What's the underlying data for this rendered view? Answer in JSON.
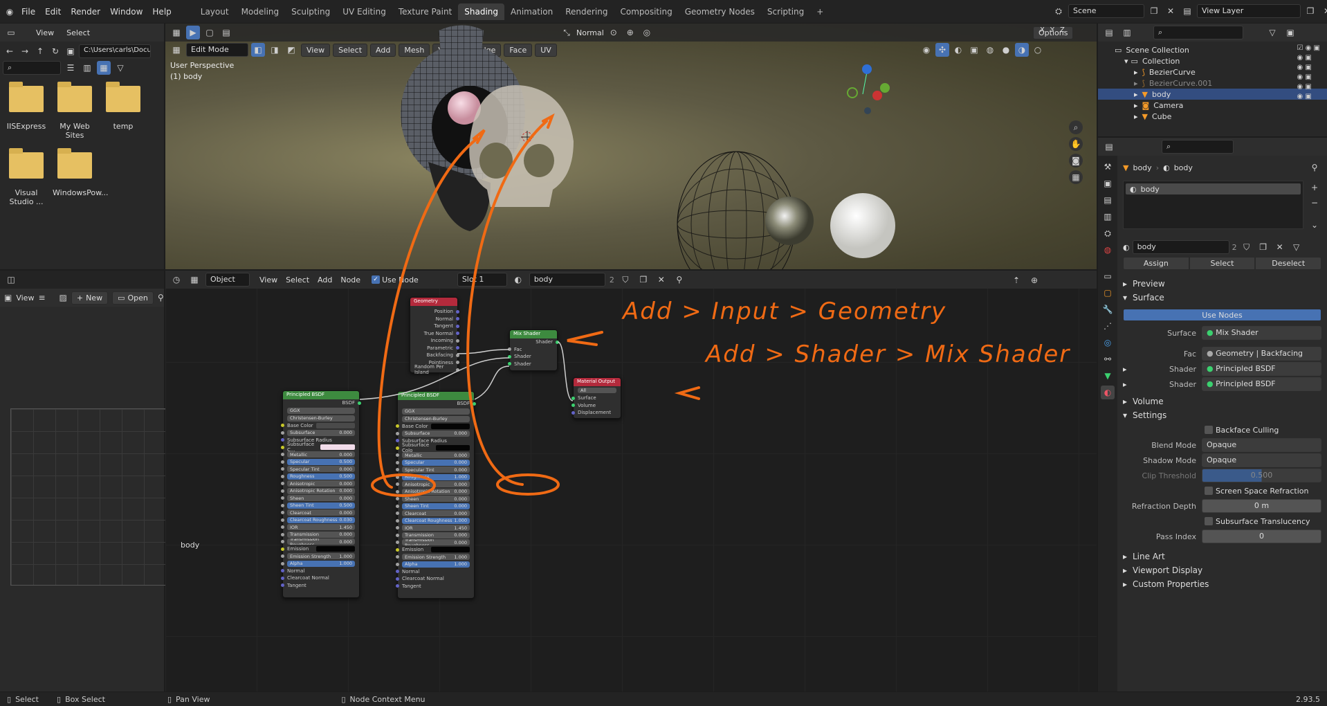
{
  "topbar": {
    "menus": [
      "File",
      "Edit",
      "Render",
      "Window",
      "Help"
    ],
    "workspaces": [
      "Layout",
      "Modeling",
      "Sculpting",
      "UV Editing",
      "Texture Paint",
      "Shading",
      "Animation",
      "Rendering",
      "Compositing",
      "Geometry Nodes",
      "Scripting"
    ],
    "active_workspace": "Shading",
    "scene": "Scene",
    "view_layer": "View Layer"
  },
  "file_browser": {
    "menus": [
      "View",
      "Select"
    ],
    "path": "C:\\Users\\carls\\Docum...",
    "folders": [
      "IISExpress",
      "My Web Sites",
      "temp",
      "Visual Studio ...",
      "WindowsPow..."
    ]
  },
  "image_editor": {
    "view": "View",
    "new": "New",
    "open": "Open"
  },
  "viewport": {
    "mode": "Edit Mode",
    "menus": [
      "View",
      "Select",
      "Add",
      "Mesh",
      "Vertex",
      "Edge",
      "Face",
      "UV"
    ],
    "perspective": "User Perspective",
    "object": "(1) body",
    "shading": "Normal",
    "options": "Options",
    "axes": [
      "X",
      "Y",
      "Z"
    ]
  },
  "node_editor": {
    "type": "Object",
    "menus": [
      "View",
      "Select",
      "Add",
      "Node"
    ],
    "use_nodes": "Use Node",
    "slot": "Slot 1",
    "material": "body",
    "users": "2",
    "label": "body",
    "geometry_node": {
      "title": "Geometry",
      "outputs": [
        "Position",
        "Normal",
        "Tangent",
        "True Normal",
        "Incoming",
        "Parametric",
        "Backfacing",
        "Pointiness",
        "Random Per Island"
      ]
    },
    "mix_node": {
      "title": "Mix Shader",
      "output": "Shader",
      "inputs": [
        "Fac",
        "Shader",
        "Shader"
      ]
    },
    "output_node": {
      "title": "Material Output",
      "target": "All",
      "inputs": [
        "Surface",
        "Volume",
        "Displacement"
      ]
    },
    "bsdf1": {
      "title": "Principled BSDF",
      "out": "BSDF",
      "dist": "GGX",
      "sss": "Christensen-Burley",
      "rows": [
        [
          "Base Color",
          ""
        ],
        [
          "Subsurface",
          "0.000"
        ],
        [
          "Subsurface Radius",
          ""
        ],
        [
          "Subsurface C...",
          ""
        ],
        [
          "Metallic",
          "0.000"
        ],
        [
          "Specular",
          "0.500"
        ],
        [
          "Specular Tint",
          "0.000"
        ],
        [
          "Roughness",
          "0.500"
        ],
        [
          "Anisotropic",
          "0.000"
        ],
        [
          "Anisotropic Rotation",
          "0.000"
        ],
        [
          "Sheen",
          "0.000"
        ],
        [
          "Sheen Tint",
          "0.500"
        ],
        [
          "Clearcoat",
          "0.000"
        ],
        [
          "Clearcoat Roughness",
          "0.030"
        ],
        [
          "IOR",
          "1.450"
        ],
        [
          "Transmission",
          "0.000"
        ],
        [
          "Transmission Roughness",
          "0.000"
        ],
        [
          "Emission",
          ""
        ],
        [
          "Emission Strength",
          "1.000"
        ],
        [
          "Alpha",
          "1.000"
        ],
        [
          "Normal",
          ""
        ],
        [
          "Clearcoat Normal",
          ""
        ],
        [
          "Tangent",
          ""
        ]
      ]
    },
    "bsdf2": {
      "title": "Principled BSDF",
      "out": "BSDF",
      "dist": "GGX",
      "sss": "Christensen-Burley",
      "rows": [
        [
          "Base Color",
          ""
        ],
        [
          "Subsurface",
          "0.000"
        ],
        [
          "Subsurface Radius",
          ""
        ],
        [
          "Subsurface Colo",
          ""
        ],
        [
          "Metallic",
          "0.000"
        ],
        [
          "Specular",
          "0.000"
        ],
        [
          "Specular Tint",
          "0.000"
        ],
        [
          "Roughness",
          "1.000"
        ],
        [
          "Anisotropic",
          "0.000"
        ],
        [
          "Anisotropic Rotation",
          "0.000"
        ],
        [
          "Sheen",
          "0.000"
        ],
        [
          "Sheen Tint",
          "0.000"
        ],
        [
          "Clearcoat",
          "0.000"
        ],
        [
          "Clearcoat Roughness",
          "1.000"
        ],
        [
          "IOR",
          "1.450"
        ],
        [
          "Transmission",
          "0.000"
        ],
        [
          "Transmission Roughness",
          "0.000"
        ],
        [
          "Emission",
          ""
        ],
        [
          "Emission Strength",
          "1.000"
        ],
        [
          "Alpha",
          "1.000"
        ],
        [
          "Normal",
          ""
        ],
        [
          "Clearcoat Normal",
          ""
        ],
        [
          "Tangent",
          ""
        ]
      ]
    },
    "note1": "Add > Input > Geometry",
    "note2": "Add > Shader > Mix Shader"
  },
  "outliner": {
    "root": "Scene Collection",
    "collection": "Collection",
    "items": [
      "BezierCurve",
      "BezierCurve.001",
      "body",
      "Camera",
      "Cube"
    ]
  },
  "properties": {
    "crumb_obj": "body",
    "crumb_mat": "body",
    "slot": "body",
    "material": "body",
    "users": "2",
    "assign": "Assign",
    "select": "Select",
    "deselect": "Deselect",
    "preview": "Preview",
    "surface": "Surface",
    "use_nodes": "Use Nodes",
    "surface_lbl": "Surface",
    "surface_val": "Mix Shader",
    "fac_lbl": "Fac",
    "fac_val": "Geometry | Backfacing",
    "shader_lbl": "Shader",
    "shader_val": "Principled BSDF",
    "volume": "Volume",
    "settings": "Settings",
    "backface": "Backface Culling",
    "blend_lbl": "Blend Mode",
    "blend_val": "Opaque",
    "shadow_lbl": "Shadow Mode",
    "shadow_val": "Opaque",
    "clip_lbl": "Clip Threshold",
    "clip_val": "0.500",
    "ssr": "Screen Space Refraction",
    "refr_lbl": "Refraction Depth",
    "refr_val": "0 m",
    "sst": "Subsurface Translucency",
    "pass_lbl": "Pass Index",
    "pass_val": "0",
    "line_art": "Line Art",
    "viewport_display": "Viewport Display",
    "custom": "Custom Properties"
  },
  "statusbar": {
    "select": "Select",
    "box": "Box Select",
    "pan": "Pan View",
    "ctx": "Node Context Menu",
    "version": "2.93.5"
  }
}
